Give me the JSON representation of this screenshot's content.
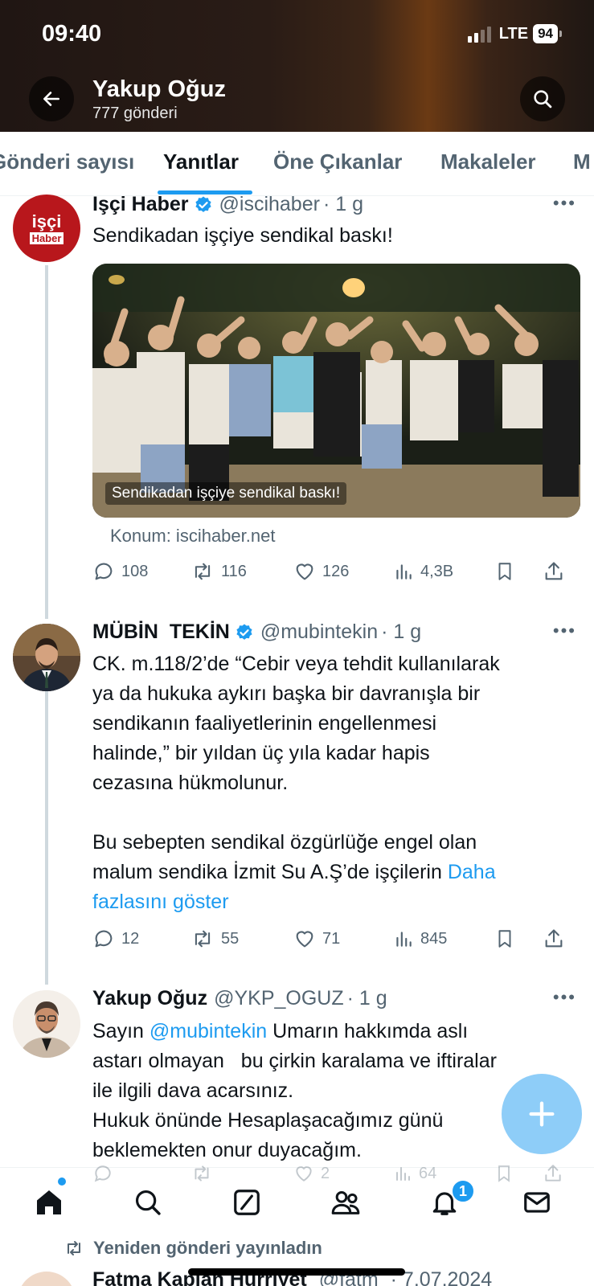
{
  "status_bar": {
    "time": "09:40",
    "network": "LTE",
    "battery": "94"
  },
  "header": {
    "title": "Yakup Oğuz",
    "post_count": "777 gönderi",
    "back_icon": "arrow-left-icon",
    "search_icon": "search-icon"
  },
  "tabs": [
    {
      "label": "Gönderi sayısı"
    },
    {
      "label": "Yanıtlar",
      "active": true
    },
    {
      "label": "Öne Çıkanlar"
    },
    {
      "label": "Makaleler"
    },
    {
      "label": "M"
    }
  ],
  "posts": [
    {
      "name": "Işçi Haber",
      "handle": "@iscihaber",
      "time": "· 1 g",
      "avatar_text_top": "işçi",
      "avatar_text_bottom": "Haber",
      "text": "Sendikadan işçiye sendikal baskı!",
      "media_caption": "Sendikadan işçiye sendikal baskı!",
      "location": "Konum: iscihaber.net",
      "replies": "108",
      "reposts": "116",
      "likes": "126",
      "views": "4,3B"
    },
    {
      "name": "MÜBİN  TEKİN",
      "handle": "@mubintekin",
      "time": "· 1 g",
      "text_lines": [
        "CK. m.118/2’de “Cebir veya tehdit kullanılarak",
        "ya da hukuka aykırı başka bir davranışla bir",
        "sendikanın faaliyetlerinin engellenmesi",
        "halinde,” bir yıldan üç yıla kadar hapis",
        "cezasına hükmolunur."
      ],
      "text2_line1": "Bu sebepten sendikal özgürlüğe engel olan",
      "text2_line2": "malum sendika İzmit Su A.Ş’de işçilerin",
      "show_more_1": "Daha",
      "show_more_2": "fazlasını göster",
      "replies": "12",
      "reposts": "55",
      "likes": "71",
      "views": "845"
    },
    {
      "name": "Yakup Oğuz",
      "handle": "@YKP_OGUZ",
      "time": "· 1 g",
      "greeting": "Sayın",
      "mention": "@mubintekin",
      "line1_rest": " Umarın hakkımda aslı",
      "lines": [
        "astarı olmayan   bu çirkin karalama ve iftiralar",
        "ile ilgili dava acarsınız.",
        "Hukuk önünde Hesaplaşacağımız günü",
        "beklemekten onur duyacağım."
      ],
      "likes": "2",
      "views": "64"
    }
  ],
  "fab": {
    "icon": "plus-icon"
  },
  "bottom_nav": {
    "items": [
      "home-icon",
      "search-icon",
      "grok-icon",
      "communities-icon",
      "notifications-icon",
      "messages-icon"
    ],
    "notification_badge": "1"
  },
  "repost_note": "Yeniden gönderi yayınladın",
  "next_post": {
    "name": "Fatma Kaplan Hürriyet",
    "handle": "@fatm",
    "date": "· 7.07.2024"
  },
  "colors": {
    "accent": "#1d9bf0",
    "secondary_text": "#536471",
    "fab": "#8ecdf8"
  }
}
